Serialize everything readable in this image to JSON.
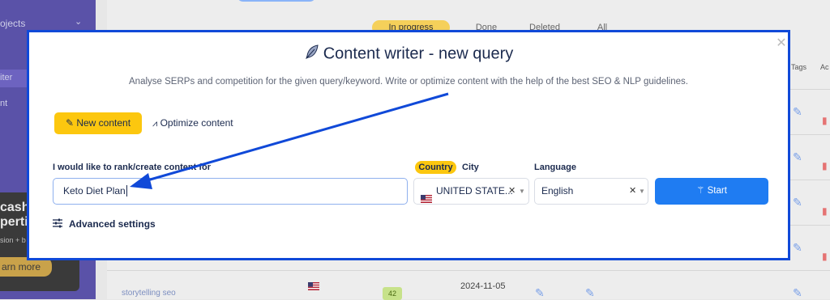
{
  "background": {
    "sidebar": {
      "top_item": "ojects",
      "items": [
        "iter",
        "nt"
      ],
      "promo": {
        "title_line1": "cash a",
        "title_line2": "pertise",
        "text": "sion + b",
        "button": "arn more"
      }
    },
    "status_tabs": [
      "In progress",
      "Done",
      "Deleted",
      "All"
    ],
    "column_headers": [
      "Tags",
      "Ac"
    ],
    "row": {
      "query": "storytelling seo",
      "score": "42",
      "date": "2024-11-05"
    }
  },
  "modal": {
    "title": "Content writer - new query",
    "subtitle": "Analyse SERPs and competition for the given query/keyword. Write or optimize content with the help of the best SEO & NLP guidelines.",
    "close_icon": "close-icon",
    "tabs": {
      "new_content": "New content",
      "optimize_content": "Optimize content"
    },
    "form": {
      "query_label": "I would like to rank/create content for",
      "query_value": "Keto Diet Plan",
      "country_badge": "Country",
      "city_label": "City",
      "country_value": "UNITED STATE...",
      "language_label": "Language",
      "language_value": "English",
      "start_button": "Start"
    },
    "advanced_settings": "Advanced settings"
  },
  "colors": {
    "accent_yellow": "#fcc70f",
    "primary_blue": "#1f7cf2",
    "annotation_blue": "#1049d8",
    "sidebar_purple": "#5a52a8"
  }
}
